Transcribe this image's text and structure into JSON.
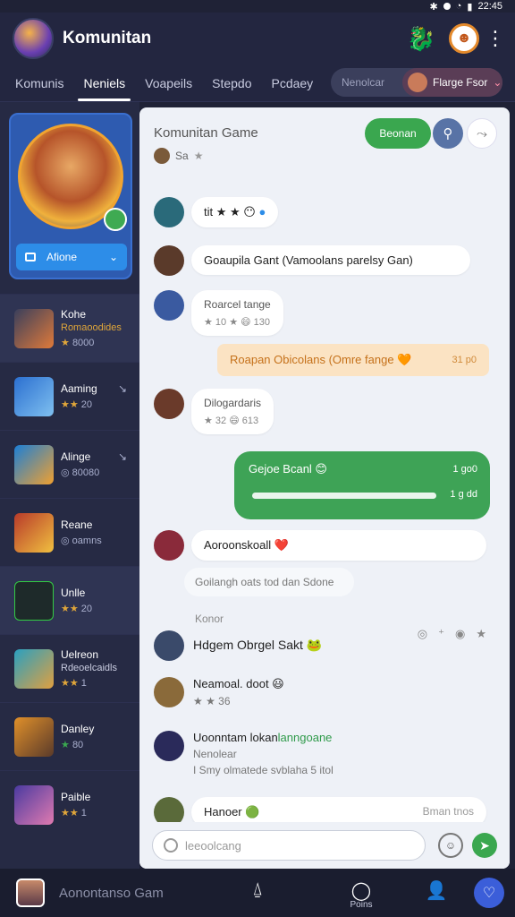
{
  "status": {
    "time": "22:45"
  },
  "header": {
    "title": "Komunitan"
  },
  "tabs": [
    "Komunis",
    "Neniels",
    "Voapeils",
    "Stepdo",
    "Pcdaey"
  ],
  "tab_search": {
    "placeholder": "Nenolcar",
    "selected": "Flarge Fsor"
  },
  "profile": {
    "select_label": "Afione"
  },
  "games": [
    {
      "name": "Kohe",
      "sub": "Romaoodides",
      "rating": "8000",
      "stars": "★"
    },
    {
      "name": "Aaming",
      "sub": "",
      "rating": "20",
      "stars": "★★"
    },
    {
      "name": "Alinge",
      "sub": "",
      "rating": "80080",
      "stars": "◎"
    },
    {
      "name": "Reane",
      "sub": "",
      "rating": "oamns",
      "stars": "◎"
    },
    {
      "name": "Unlle",
      "sub": "",
      "rating": "20",
      "stars": "★★"
    },
    {
      "name": "Uelreon",
      "sub": "Rdeoelcaidls",
      "rating": "1",
      "stars": "★★"
    },
    {
      "name": "Danley",
      "sub": "",
      "rating": "80",
      "stars": "★"
    },
    {
      "name": "Paible",
      "sub": "",
      "rating": "1",
      "stars": "★★"
    }
  ],
  "chat": {
    "title": "Komunitan Game",
    "subtitle": "Sa",
    "join_label": "Beonan",
    "msg1_meta": "tit ★ ★",
    "msg2_text": "Goaupila Gant (Vamoolans parelsy Gan)",
    "msg3_name": "Roarcel tange",
    "msg3_meta": "★ 10 ★ 😄 130",
    "notice_text": "Roapan Obicolans (Omre fange 🧡",
    "notice_time": "31 p0",
    "msg4_name": "Dilogardaris",
    "msg4_meta": "★ 32 😄 613",
    "green_title": "Gejoe Bcanl 😊",
    "green_time": "1 go0",
    "green_time2": "1 g dd",
    "msg5_text": "Aoroonskoall ❤️",
    "chip_text": "Goilangh oats tod dan Sdone",
    "section_label": "Konor",
    "p1_name": "Hdgem Obrgel Sakt 🐸",
    "p2_name": "Neamoal. doot 😃",
    "p2_meta": "★ ★ 36",
    "p3_name": "Uoonntam lokan",
    "p3_green": "lanngoane",
    "p3_line2": "Nenolear",
    "p3_line3": "I Smy olmatede svblaha 5 itol",
    "p4_name": "Hanoer 🟢",
    "p4_right": "Bman tnos",
    "input_placeholder": "leeoolcang"
  },
  "bottom": {
    "title": "Aonontanso Gam",
    "center_label": "Poins"
  }
}
